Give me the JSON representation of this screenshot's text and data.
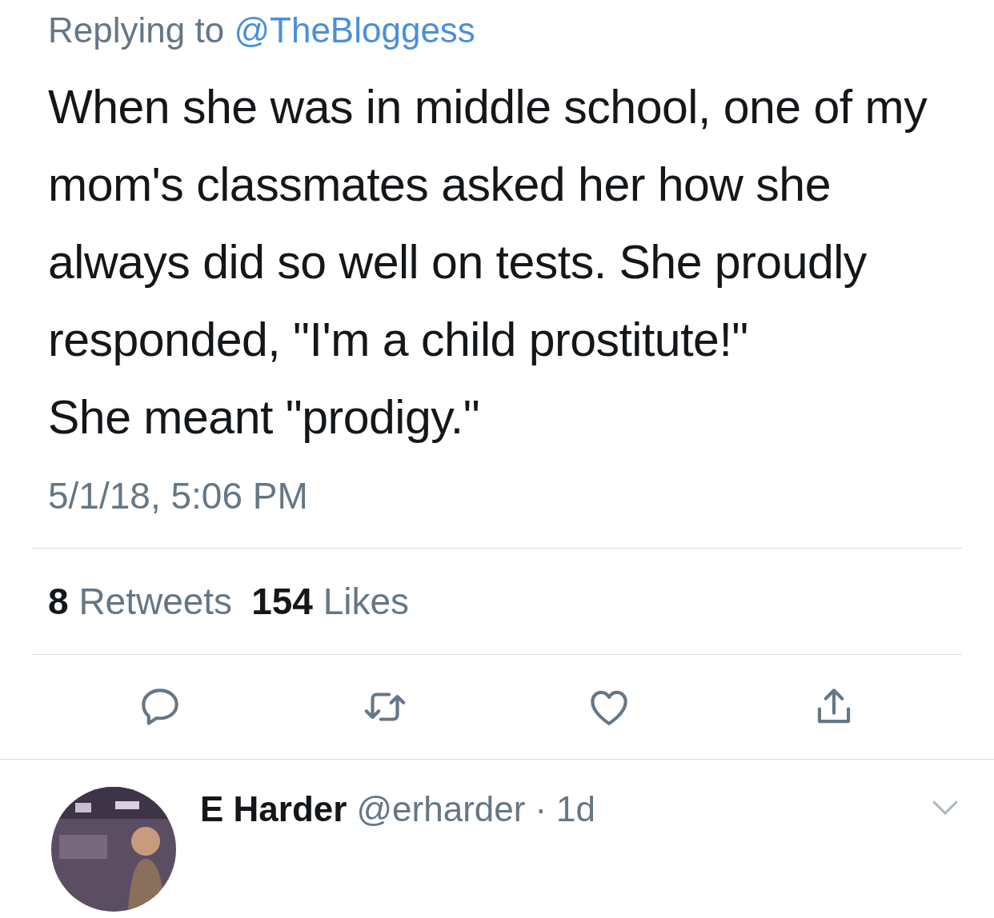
{
  "replying_to": {
    "label": "Replying to",
    "handle": "@TheBloggess"
  },
  "tweet": {
    "paragraphs": [
      "When she was in middle school, one of my mom's classmates asked her how she always did so well on tests. She proudly responded, \"I'm a child prostitute!\"",
      "She meant \"prodigy.\""
    ],
    "timestamp": "5/1/18, 5:06 PM"
  },
  "stats": [
    {
      "count": "8",
      "label": "Retweets"
    },
    {
      "count": "154",
      "label": "Likes"
    }
  ],
  "actions": [
    {
      "kind": "reply"
    },
    {
      "kind": "retweet"
    },
    {
      "kind": "like"
    },
    {
      "kind": "share"
    }
  ],
  "reply": {
    "name": "E Harder",
    "handle": "@erharder",
    "separator": "·",
    "time": "1d"
  }
}
